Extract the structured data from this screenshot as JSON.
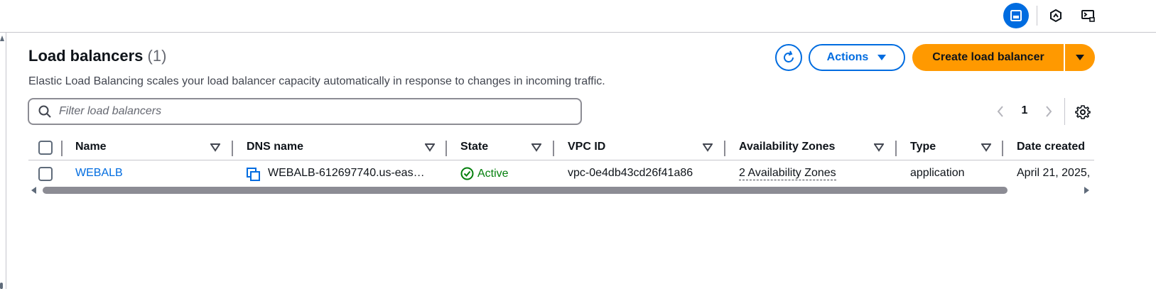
{
  "topbar": {
    "icons": [
      "panel-icon",
      "hexagon-icon",
      "screen-terminal-icon"
    ]
  },
  "header": {
    "title": "Load balancers",
    "count": "(1)",
    "description": "Elastic Load Balancing scales your load balancer capacity automatically in response to changes in incoming traffic."
  },
  "toolbar": {
    "refresh_icon": "refresh-icon",
    "actions_label": "Actions",
    "create_label": "Create load balancer"
  },
  "filter": {
    "placeholder": "Filter load balancers",
    "value": ""
  },
  "pagination": {
    "current_page": "1"
  },
  "table": {
    "columns": [
      "Name",
      "DNS name",
      "State",
      "VPC ID",
      "Availability Zones",
      "Type",
      "Date created"
    ],
    "rows": [
      {
        "name": "WEBALB",
        "dns_name": "WEBALB-612697740.us-eas…",
        "state": "Active",
        "vpc_id": "vpc-0e4db43cd26f41a86",
        "availability_zones": "2 Availability Zones",
        "type": "application",
        "date_created": "April 21, 2025,"
      }
    ]
  },
  "colors": {
    "accent": "#006ce0",
    "primary_button": "#ff9900",
    "success": "#037f0c",
    "text": "#0f141a",
    "border": "#c6c6cd"
  }
}
